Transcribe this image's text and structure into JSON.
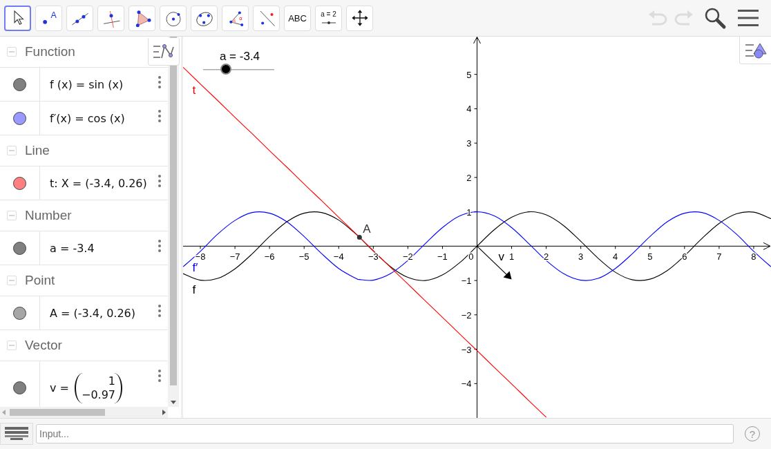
{
  "toolbar": {
    "tools": [
      {
        "kind": "move",
        "selected": true
      },
      {
        "kind": "point",
        "label": "A",
        "selected": false
      },
      {
        "kind": "line",
        "selected": false
      },
      {
        "kind": "perpendicular",
        "selected": false
      },
      {
        "kind": "polygon",
        "selected": false
      },
      {
        "kind": "circle",
        "selected": false
      },
      {
        "kind": "conic",
        "selected": false
      },
      {
        "kind": "angle",
        "label": "α",
        "selected": false
      },
      {
        "kind": "reflect",
        "selected": false
      },
      {
        "kind": "text",
        "label": "ABC",
        "selected": false
      },
      {
        "kind": "slider",
        "label": "a = 2",
        "selected": false
      },
      {
        "kind": "move-view",
        "selected": false
      }
    ],
    "undo": {
      "disabled": true
    },
    "redo": {
      "disabled": true
    }
  },
  "algebra": {
    "groups": [
      {
        "title": "Function",
        "expanded": true,
        "items": [
          {
            "kind": "formula",
            "text": "f (x) = sin (x)",
            "color": "#808080"
          },
          {
            "kind": "formula",
            "text": "f′(x) = cos (x)",
            "color": "#9999ff"
          }
        ]
      },
      {
        "title": "Line",
        "expanded": true,
        "items": [
          {
            "kind": "formula",
            "text": "t: X = (-3.4, 0.26)",
            "color": "#ff8080"
          }
        ]
      },
      {
        "title": "Number",
        "expanded": true,
        "items": [
          {
            "kind": "formula",
            "text": "a = -3.4",
            "color": "#808080"
          }
        ]
      },
      {
        "title": "Point",
        "expanded": true,
        "items": [
          {
            "kind": "formula",
            "text": "A = (-3.4, 0.26)",
            "color": "#a6a6a6"
          }
        ]
      },
      {
        "title": "Vector",
        "expanded": true,
        "items": [
          {
            "kind": "vector",
            "text": "v =",
            "components": [
              "1",
              "−0.97"
            ],
            "color": "#808080"
          }
        ]
      }
    ]
  },
  "graphics": {
    "slider": {
      "label": "a = -3.4",
      "level": 0.33
    },
    "objects": [
      {
        "kind": "point",
        "label": "A"
      },
      {
        "kind": "vector",
        "label": "v"
      }
    ],
    "chart_data": {
      "type": "line",
      "xlim": [
        -8.5,
        8.5
      ],
      "ylim": [
        -5,
        6.1
      ],
      "x": [
        -8.5,
        -8,
        -7.5,
        -7,
        -6.5,
        -6,
        -5.5,
        -5,
        -4.5,
        -4,
        -3.5,
        -3.4,
        -3,
        -2.5,
        -2,
        -1.5,
        -1,
        -0.5,
        0,
        0.5,
        1,
        1.5,
        2,
        2.5,
        3,
        3.5,
        4,
        4.5,
        5,
        5.5,
        6,
        6.5,
        7,
        7.5,
        8,
        8.5
      ],
      "xticks": [
        {
          "value": -8,
          "label": "−8"
        },
        {
          "value": -7,
          "label": "−7"
        },
        {
          "value": -6,
          "label": "−6"
        },
        {
          "value": -5,
          "label": "−5"
        },
        {
          "value": -4,
          "label": "−4"
        },
        {
          "value": -3,
          "label": "−3"
        },
        {
          "value": -2,
          "label": "−2"
        },
        {
          "value": -1,
          "label": "−1"
        },
        {
          "value": 0,
          "label": "0"
        },
        {
          "value": 1,
          "label": "1"
        },
        {
          "value": 2,
          "label": "2"
        },
        {
          "value": 3,
          "label": "3"
        },
        {
          "value": 4,
          "label": "4"
        },
        {
          "value": 5,
          "label": "5"
        },
        {
          "value": 6,
          "label": "6"
        },
        {
          "value": 7,
          "label": "7"
        },
        {
          "value": 8,
          "label": "8"
        }
      ],
      "yticks": [
        {
          "value": -4,
          "label": "−4"
        },
        {
          "value": -3,
          "label": "−3"
        },
        {
          "value": -2,
          "label": "−2"
        },
        {
          "value": -1,
          "label": "−1"
        },
        {
          "value": 1,
          "label": "1"
        },
        {
          "value": 2,
          "label": "2"
        },
        {
          "value": 3,
          "label": "3"
        },
        {
          "value": 4,
          "label": "4"
        },
        {
          "value": 5,
          "label": "5"
        }
      ],
      "series": [
        {
          "name": "f",
          "color": "#000000",
          "values": [
            -0.8,
            -0.99,
            -0.94,
            -0.66,
            -0.22,
            0.28,
            0.71,
            0.96,
            0.98,
            0.76,
            0.35,
            0.26,
            -0.14,
            -0.6,
            -0.91,
            -1,
            -0.84,
            -0.48,
            0,
            0.48,
            0.84,
            1,
            0.91,
            0.6,
            0.14,
            -0.35,
            -0.76,
            -0.98,
            -0.96,
            -0.71,
            -0.28,
            0.22,
            0.66,
            0.94,
            0.99,
            0.8
          ]
        },
        {
          "name": "f′",
          "color": "#0000ff",
          "values": [
            -0.6,
            -0.15,
            0.35,
            0.75,
            0.98,
            0.96,
            0.71,
            0.28,
            -0.21,
            -0.65,
            -0.94,
            -0.97,
            -0.99,
            -0.8,
            -0.42,
            0.07,
            0.54,
            0.88,
            1,
            0.88,
            0.54,
            0.07,
            -0.42,
            -0.8,
            -0.99,
            -0.94,
            -0.65,
            -0.21,
            0.28,
            0.71,
            0.96,
            0.98,
            0.75,
            0.35,
            -0.15,
            -0.6
          ]
        },
        {
          "name": "t",
          "color": "#ff0000",
          "values": [
            5.21,
            4.72,
            4.24,
            3.75,
            3.27,
            2.78,
            2.3,
            1.81,
            1.33,
            0.84,
            0.36,
            0.26,
            -0.13,
            -0.62,
            -1.1,
            -1.59,
            -2.07,
            -2.56,
            -3.04,
            -3.53,
            -4.01,
            -4.5,
            -4.98,
            null,
            null,
            null,
            null,
            null,
            null,
            null,
            null,
            null,
            null,
            null,
            null,
            null
          ]
        }
      ]
    }
  },
  "input_bar": {
    "placeholder": "Input...",
    "help": "?"
  }
}
